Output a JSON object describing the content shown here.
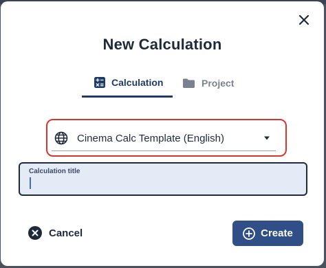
{
  "dialog": {
    "title": "New Calculation",
    "close_icon": "close-icon"
  },
  "tabs": [
    {
      "label": "Calculation",
      "icon": "calculator-icon",
      "active": true
    },
    {
      "label": "Project",
      "icon": "folder-icon",
      "active": false
    }
  ],
  "template_select": {
    "icon": "globe-icon",
    "value": "Cinema Calc Template (English)",
    "dropdown_icon": "caret-down-icon"
  },
  "title_field": {
    "label": "Calculation title",
    "value": ""
  },
  "actions": {
    "cancel_label": "Cancel",
    "cancel_icon": "cancel-circle-icon",
    "create_label": "Create",
    "create_icon": "plus-circle-icon"
  },
  "colors": {
    "accent": "#2f4f86",
    "active_tab": "#1e3a6b",
    "highlight_border": "#d9342b",
    "field_background": "#e4ebf6"
  }
}
